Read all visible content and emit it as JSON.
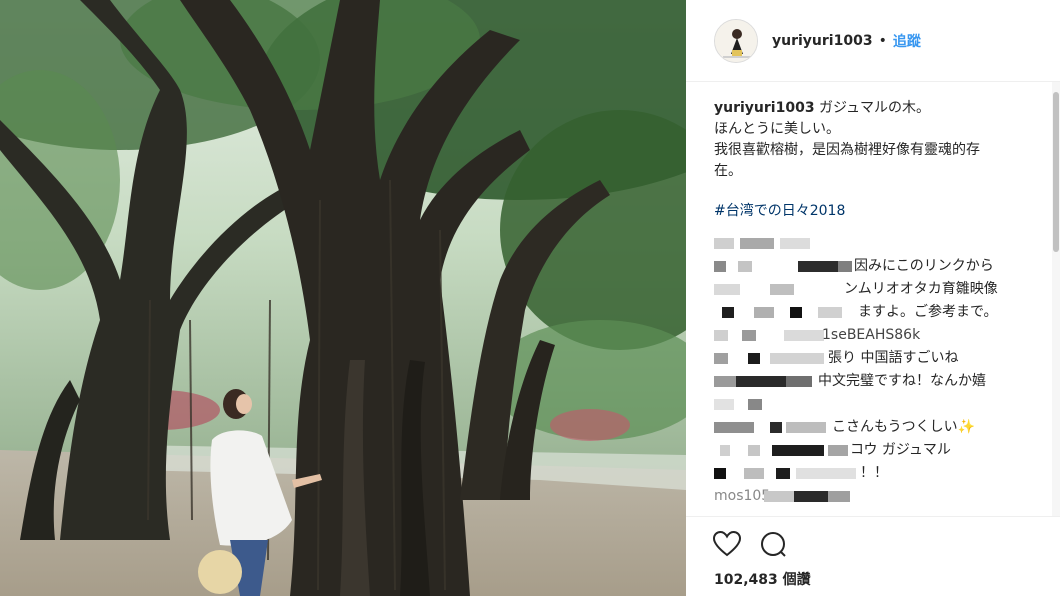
{
  "post": {
    "username": "yuriyuri1003",
    "separator": "•",
    "follow_label": "追蹤",
    "caption": {
      "username": "yuriyuri1003",
      "line1": "ガジュマルの木。",
      "line2": "ほんとうに美しい。",
      "line3": "我很喜歡榕樹，是因為樹裡好像有靈魂的存",
      "line4": "在。",
      "hashtag": "#台湾での日々2018"
    },
    "comments": [
      {
        "text": ""
      },
      {
        "text": "因みにこのリンクから"
      },
      {
        "text": "ンムリオオタカ育雛映像"
      },
      {
        "text": "ますよ。ご参考まで。"
      },
      {
        "text": "1seBEAHS86k"
      },
      {
        "text": "張り 中国語すごいね"
      },
      {
        "text": "中文完璧ですね！なんか嬉"
      },
      {
        "text": ""
      },
      {
        "text": "こさんもうつくしい✨"
      },
      {
        "text": "コウ ガジュマル"
      },
      {
        "text": "！！"
      },
      {
        "text": "mos105"
      }
    ],
    "likes": "102,483 個讚"
  },
  "icons": [
    "avatar-icon",
    "heart-icon",
    "comment-icon"
  ],
  "colors": {
    "link": "#3897f0",
    "hashtag": "#003569",
    "text": "#262626"
  }
}
